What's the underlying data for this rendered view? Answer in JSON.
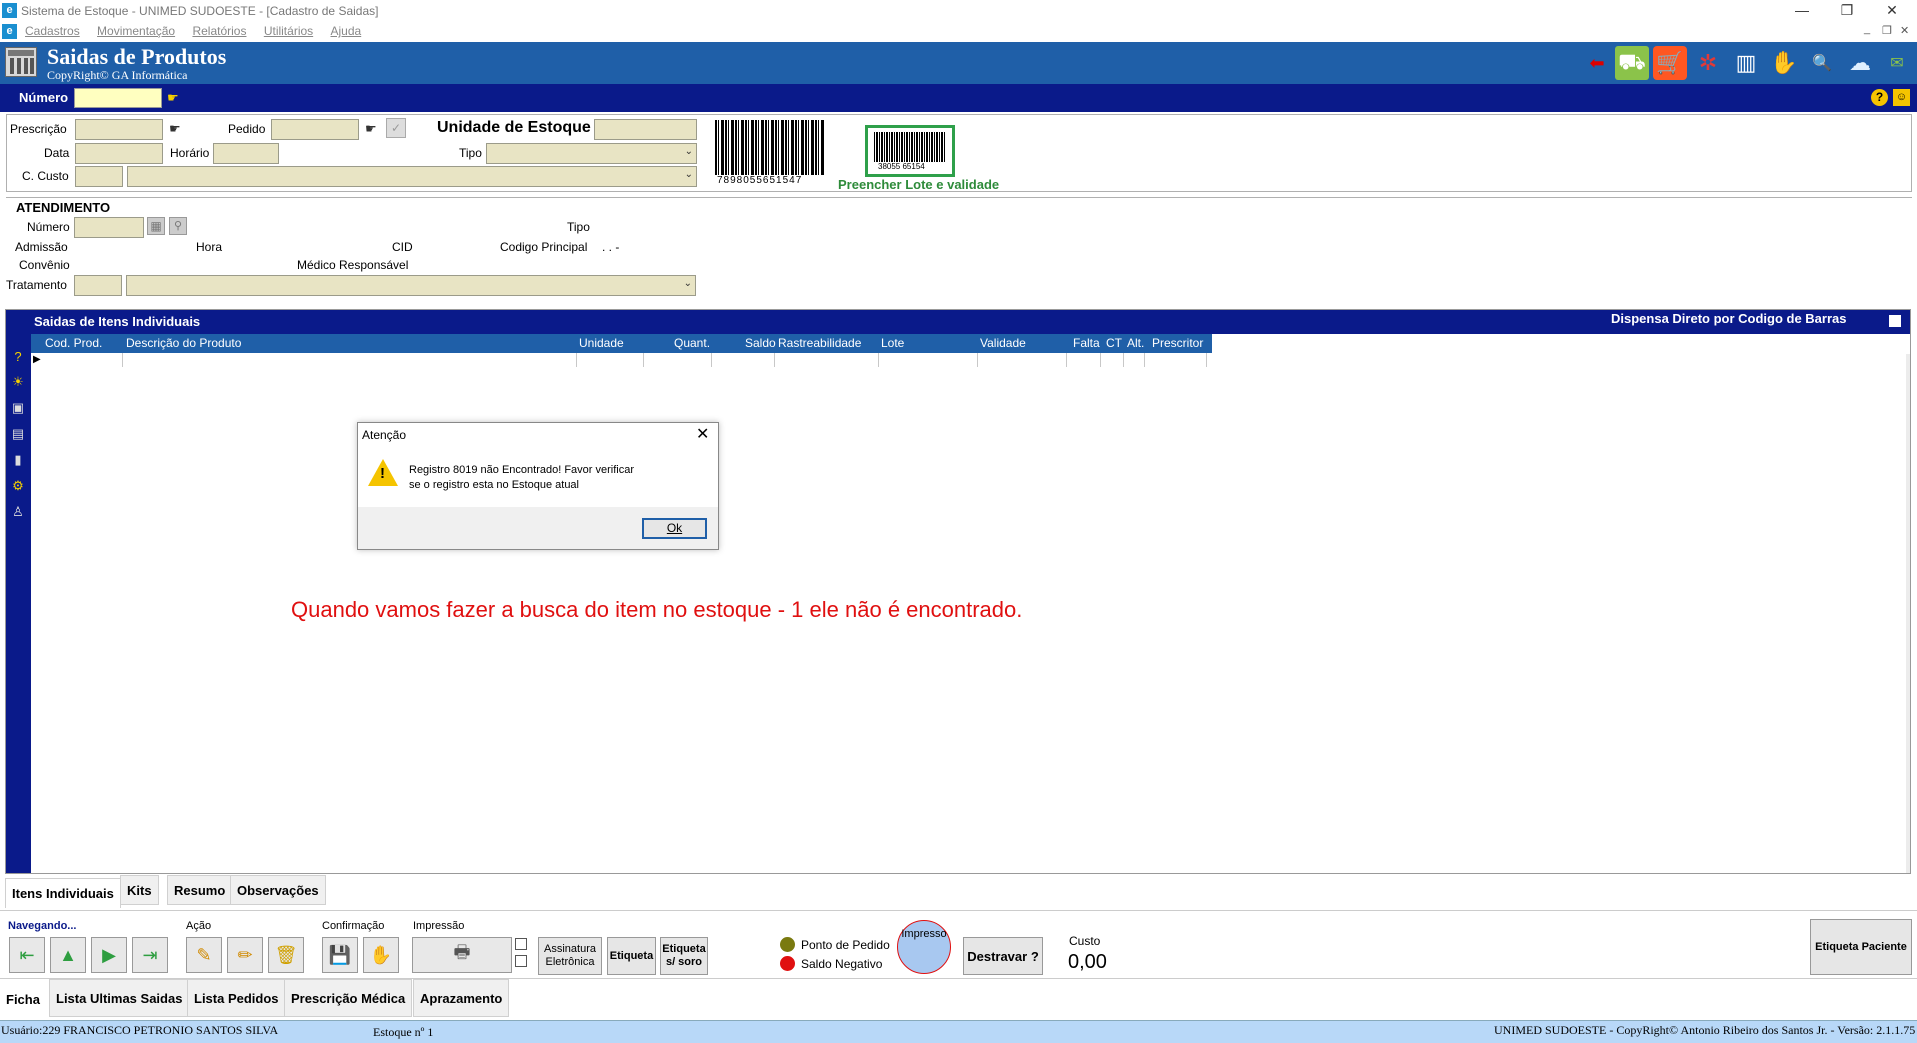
{
  "window": {
    "title": "Sistema de Estoque - UNIMED SUDOESTE - [Cadastro de Saidas]",
    "controls": [
      "—",
      "❐",
      "✕"
    ],
    "mdi_controls": [
      "_",
      "❐",
      "✕"
    ]
  },
  "menu": [
    "Cadastros",
    "Movimentação",
    "Relatórios",
    "Utilitários",
    "Ajuda"
  ],
  "header": {
    "title": "Saidas de Produtos",
    "subtitle": "CopyRight© GA Informática",
    "bg_color": "#1f5fa8"
  },
  "numero_bar": {
    "label": "Número"
  },
  "form": {
    "prescricao": "Prescrição",
    "pedido": "Pedido",
    "unidade_estoque": "Unidade de Estoque",
    "data": "Data",
    "horario": "Horário",
    "tipo": "Tipo",
    "c_custo": "C. Custo",
    "barcode_number": "7898055651547",
    "barcode_small": "38055 65154",
    "lote_link": "Preencher Lote e validade"
  },
  "atendimento": {
    "title": "ATENDIMENTO",
    "numero": "Número",
    "tipo": "Tipo",
    "admissao": "Admissão",
    "hora": "Hora",
    "cid": "CID",
    "codigo_principal": "Codigo Principal",
    "codigo_value": ". . -",
    "convenio": "Convênio",
    "medico": "Médico Responsável",
    "tratamento": "Tratamento"
  },
  "items_panel": {
    "title": "Saidas de Itens Individuais",
    "dispensa": "Dispensa Direto por Codigo de Barras",
    "columns": [
      "Cod. Prod.",
      "Descrição do Produto",
      "Unidade",
      "Quant.",
      "Saldo",
      "Rastreabilidade",
      "Lote",
      "Validade",
      "Falta",
      "CT",
      "Alt.",
      "Prescritor"
    ]
  },
  "dialog": {
    "title": "Atenção",
    "message_line1": "Registro 8019 não Encontrado! Favor verificar",
    "message_line2": "se o registro esta no Estoque atual",
    "ok": "Ok"
  },
  "annotation": "Quando vamos fazer a busca do item no estoque - 1 ele não é encontrado.",
  "tabs_top": [
    "Itens Individuais",
    "Kits",
    "Resumo",
    "Observações"
  ],
  "bottom": {
    "navegando": "Navegando...",
    "acao": "Ação",
    "confirmacao": "Confirmação",
    "impressao": "Impressão",
    "assinatura": "Assinatura Eletrônica",
    "etiqueta": "Etiqueta",
    "etiqueta_soro": "Etiqueta s/ soro",
    "ponto_pedido": "Ponto de Pedido",
    "saldo_negativo": "Saldo Negativo",
    "impresso": "Impresso",
    "destravar": "Destravar ?",
    "custo_label": "Custo",
    "custo_value": "0,00",
    "etiqueta_paciente": "Etiqueta Paciente"
  },
  "tabs_bottom": [
    "Ficha",
    "Lista Ultimas Saidas",
    "Lista Pedidos",
    "Prescrição Médica",
    "Aprazamento"
  ],
  "status": {
    "user": "Usuário:229 FRANCISCO PETRONIO SANTOS SILVA",
    "estoque": "Estoque nº 1",
    "copyright": "UNIMED SUDOESTE - CopyRight© Antonio Ribeiro dos Santos Jr. - Versão: 2.1.1.75"
  }
}
